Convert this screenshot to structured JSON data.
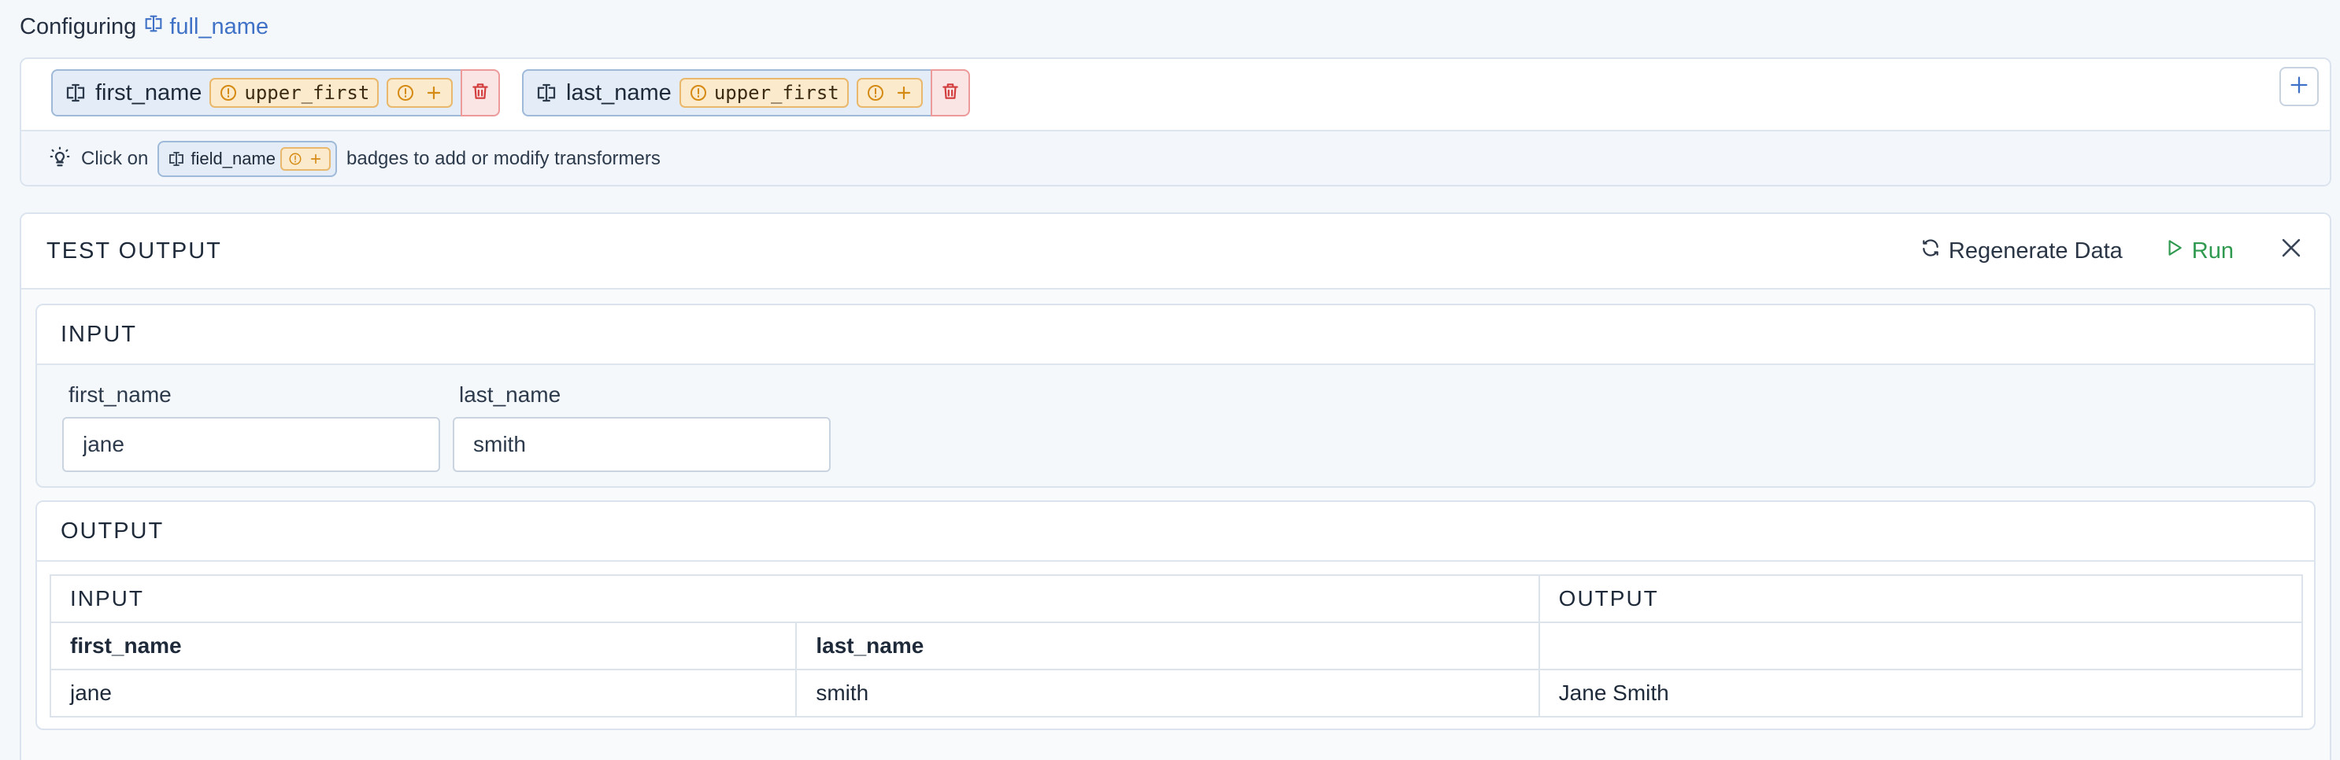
{
  "header": {
    "configuring_label": "Configuring",
    "field_name": "full_name"
  },
  "fields": [
    {
      "name": "first_name",
      "transformer": "upper_first"
    },
    {
      "name": "last_name",
      "transformer": "upper_first"
    }
  ],
  "hint": {
    "prefix": "Click on",
    "chip_label": "field_name",
    "suffix": "badges to add or modify transformers"
  },
  "test_output": {
    "title": "TEST OUTPUT",
    "regenerate_label": "Regenerate Data",
    "run_label": "Run",
    "input_section": {
      "title": "INPUT",
      "fields": [
        {
          "label": "first_name",
          "value": "jane"
        },
        {
          "label": "last_name",
          "value": "smith"
        }
      ]
    },
    "output_section": {
      "title": "OUTPUT",
      "table": {
        "group_headers": [
          "INPUT",
          "OUTPUT"
        ],
        "columns": [
          "first_name",
          "last_name",
          ""
        ],
        "rows": [
          [
            "jane",
            "smith",
            "Jane Smith"
          ]
        ]
      }
    }
  },
  "colors": {
    "accent": "#3f71c6",
    "run_green": "#2f9a4f",
    "transformer_bg": "#fbeacb",
    "delete_bg": "#fbe4e4"
  }
}
